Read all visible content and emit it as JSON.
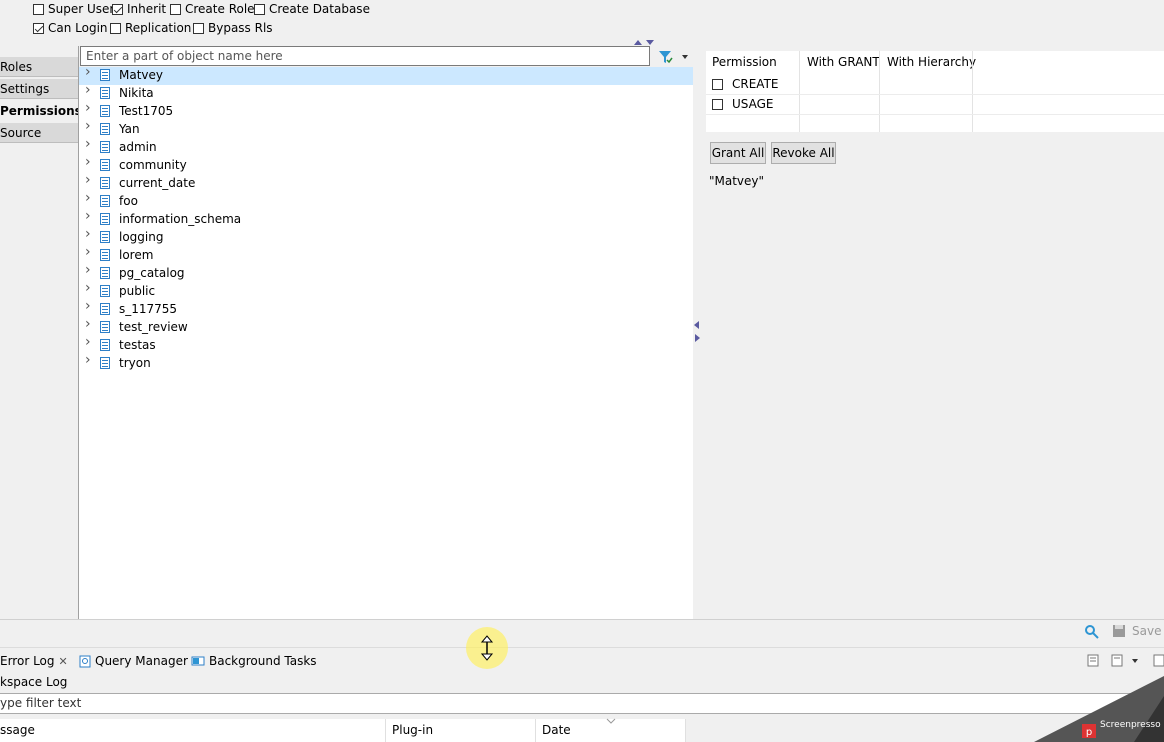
{
  "flags": {
    "super_user": {
      "label": "Super User",
      "checked": false
    },
    "inherit": {
      "label": "Inherit",
      "checked": true
    },
    "create_role": {
      "label": "Create Role",
      "checked": false
    },
    "create_database": {
      "label": "Create Database",
      "checked": false
    },
    "can_login": {
      "label": "Can Login",
      "checked": true
    },
    "replication": {
      "label": "Replication",
      "checked": false
    },
    "bypass_rls": {
      "label": "Bypass Rls",
      "checked": false
    }
  },
  "tabs": [
    {
      "label": "Roles",
      "active": false
    },
    {
      "label": "Settings",
      "active": false
    },
    {
      "label": "Permissions",
      "active": true
    },
    {
      "label": "Source",
      "active": false
    }
  ],
  "filter": {
    "placeholder": "Enter a part of object name here"
  },
  "tree_items": [
    "Matvey",
    "Nikita",
    "Test1705",
    "Yan",
    "admin",
    "community",
    "current_date",
    "foo",
    "information_schema",
    "logging",
    "lorem",
    "pg_catalog",
    "public",
    "s_117755",
    "test_review",
    "testas",
    "tryon"
  ],
  "selected_item": "Matvey",
  "permissions": {
    "headers": [
      "Permission",
      "With GRANT",
      "With Hierarchy"
    ],
    "rows": [
      {
        "name": "CREATE",
        "checked": false
      },
      {
        "name": "USAGE",
        "checked": false
      }
    ]
  },
  "buttons": {
    "grant_all": "Grant All",
    "revoke_all": "Revoke All",
    "save": "Save ..."
  },
  "selected_object_label": "\"Matvey\"",
  "bottom": {
    "tabs": [
      "Error Log",
      "Query Manager",
      "Background Tasks"
    ],
    "workspace_log": "kspace Log",
    "filter_text": "ype filter text",
    "columns": [
      "ssage",
      "Plug-in",
      "Date"
    ]
  },
  "watermark": "Screenpresso"
}
